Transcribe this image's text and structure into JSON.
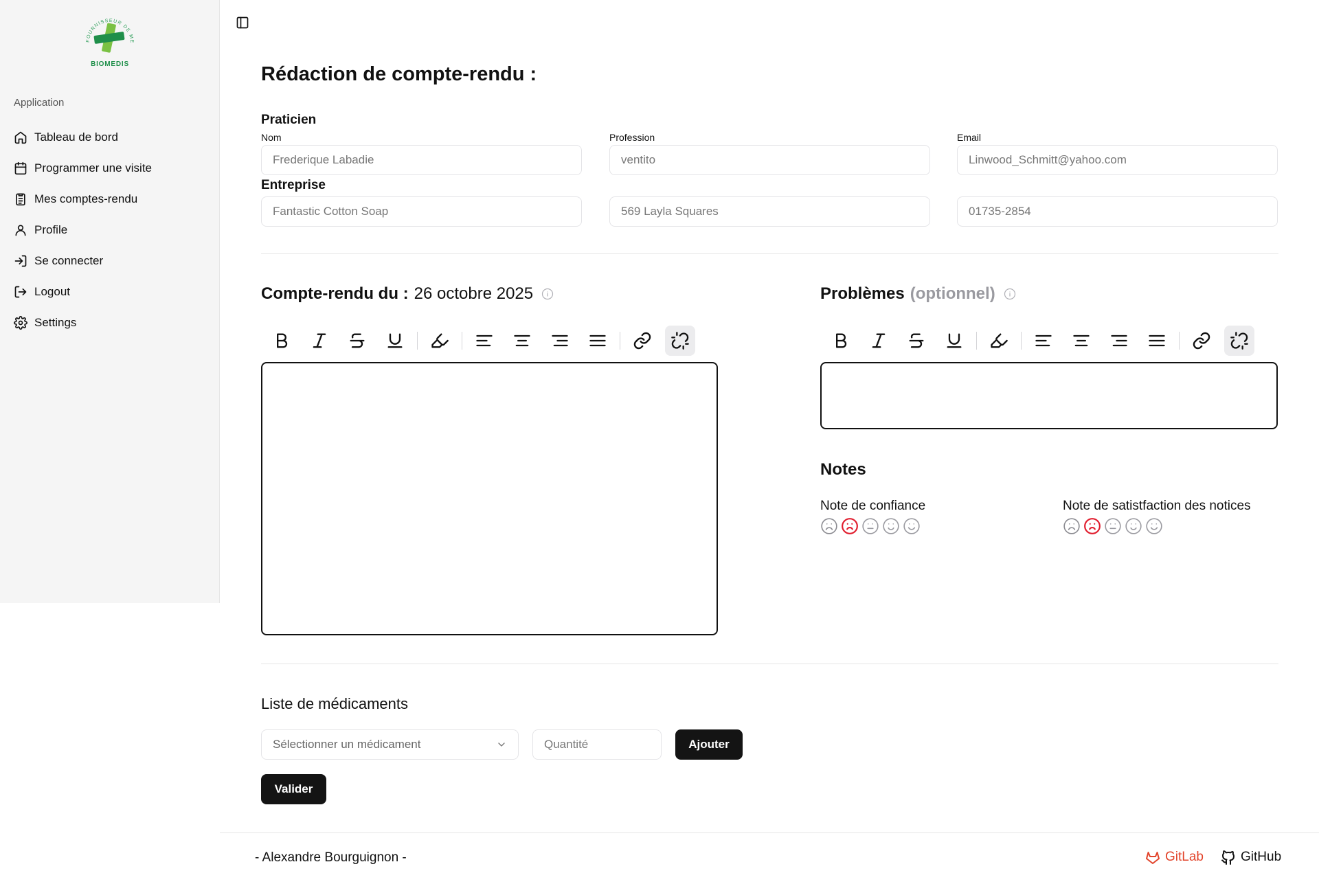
{
  "sidebar": {
    "logo_text": "BIOMEDIS",
    "logo_ring_text": "FOURNISSEUR DE MEDICAMENTS",
    "group_label": "Application",
    "items": [
      {
        "label": "Tableau de bord",
        "icon": "home-icon"
      },
      {
        "label": "Programmer une visite",
        "icon": "calendar-icon"
      },
      {
        "label": "Mes comptes-rendu",
        "icon": "clipboard-icon"
      },
      {
        "label": "Profile",
        "icon": "user-icon"
      },
      {
        "label": "Se connecter",
        "icon": "login-icon"
      },
      {
        "label": "Logout",
        "icon": "logout-icon"
      },
      {
        "label": "Settings",
        "icon": "gear-icon"
      }
    ]
  },
  "page": {
    "title": "Rédaction de compte-rendu :"
  },
  "praticien": {
    "section_label": "Praticien",
    "nom_label": "Nom",
    "nom_value": "Frederique Labadie",
    "profession_label": "Profession",
    "profession_value": "ventito",
    "email_label": "Email",
    "email_value": "Linwood_Schmitt@yahoo.com"
  },
  "entreprise": {
    "section_label": "Entreprise",
    "name_value": "Fantastic Cotton Soap",
    "address_value": "569 Layla Squares",
    "phone_value": "01735-2854"
  },
  "compte_rendu": {
    "heading": "Compte-rendu du :",
    "date": "26 octobre 2025"
  },
  "problemes": {
    "heading": "Problèmes",
    "optional": "(optionnel)"
  },
  "notes": {
    "title": "Notes",
    "confiance_label": "Note de confiance",
    "confiance_value": 2,
    "satisfaction_label": "Note de satistfaction des notices",
    "satisfaction_value": 2,
    "max": 5,
    "active_color": "#e11d2e"
  },
  "medicaments": {
    "title": "Liste de médicaments",
    "select_placeholder": "Sélectionner un médicament",
    "quantity_placeholder": "Quantité",
    "add_label": "Ajouter",
    "validate_label": "Valider"
  },
  "footer": {
    "author": "- Alexandre Bourguignon -",
    "gitlab": "GitLab",
    "github": "GitHub",
    "gitlab_color": "#e2432a"
  }
}
